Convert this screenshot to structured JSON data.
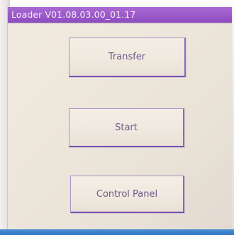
{
  "window": {
    "title": "Loader V01.08.03.00_01.17"
  },
  "buttons": {
    "transfer_label": "Transfer",
    "start_label": "Start",
    "control_panel_label": "Control Panel"
  },
  "colors": {
    "title_bar": "#9a58c9",
    "button_border": "#7a4fb0",
    "button_text": "#6f5a8c",
    "panel_background": "#ece5da",
    "bottom_bar": "#2f74c0"
  }
}
